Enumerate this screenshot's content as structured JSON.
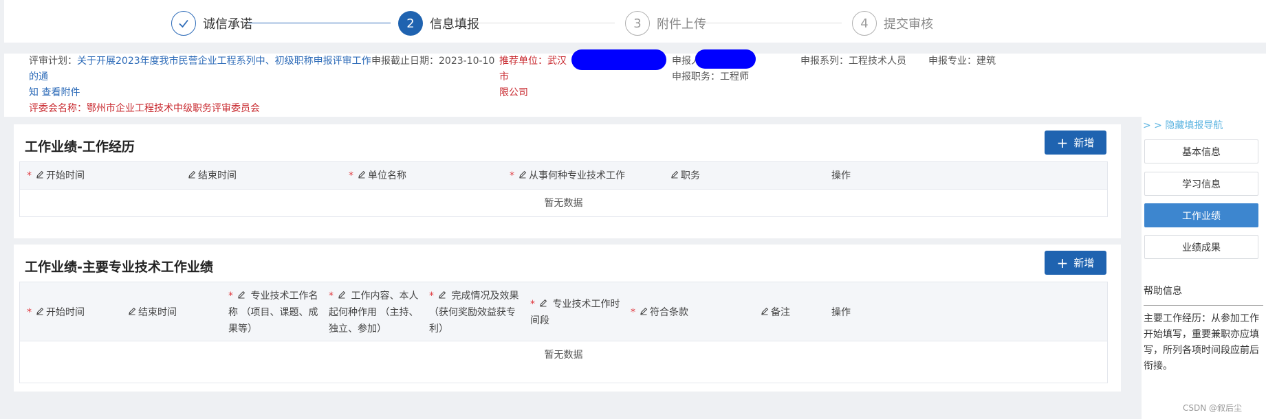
{
  "stepper": {
    "steps": [
      {
        "index": "✓",
        "label": "诚信承诺"
      },
      {
        "index": "2",
        "label": "信息填报"
      },
      {
        "index": "3",
        "label": "附件上传"
      },
      {
        "index": "4",
        "label": "提交审核"
      }
    ]
  },
  "info": {
    "plan_label": "评审计划：",
    "plan_value_line1": "关于开展2023年度我市民营企业工程系列中、初级职称申报评审工作的通",
    "plan_value_line2": "知",
    "view_attachment": "查看附件",
    "deadline_label": "申报截止日期：",
    "deadline_value": "2023-10-10",
    "committee": "评委会名称：鄂州市企业工程技术中级职务评审委员会",
    "recommend_label": "推荐单位：",
    "recommend_value_line1": "武汉市",
    "recommend_value_line2": "限公司",
    "applicant_label": "申报人",
    "position_label": "申报职务：",
    "position_value": "工程师",
    "series_label": "申报系列：",
    "series_value": "工程技术人员",
    "specialty_label": "申报专业：",
    "specialty_value": "建筑"
  },
  "section1": {
    "title": "工作业绩-工作经历",
    "add_label": "新增",
    "columns": [
      "开始时间",
      "结束时间",
      "单位名称",
      "从事何种专业技术工作",
      "职务",
      "操作"
    ],
    "empty": "暂无数据"
  },
  "section2": {
    "title": "工作业绩-主要专业技术工作业绩",
    "add_label": "新增",
    "columns": [
      "开始时间",
      "结束时间",
      "专业技术工作名称 （项目、课题、成果等）",
      "工作内容、本人起何种作用 （主持、独立、参加）",
      "完成情况及效果 （获何奖励效益获专利）",
      "专业技术工作时间段",
      "符合条款",
      "备注",
      "操作"
    ],
    "col3": [
      "专业技术工作名",
      "称 （项目、课题、成",
      "果等）"
    ],
    "col4": [
      "工作内容、本人",
      "起何种作用 （主持、",
      "独立、参加）"
    ],
    "col5": [
      "完成情况及效果",
      " （获何奖励效益获专",
      "利）"
    ],
    "col6": [
      "专业技术工作时",
      "间段"
    ],
    "empty": "暂无数据"
  },
  "sidebar": {
    "hide_nav": "> > 隐藏填报导航",
    "items": [
      "基本信息",
      "学习信息",
      "工作业绩",
      "业绩成果"
    ],
    "active": "工作业绩",
    "help_title": "帮助信息",
    "help_text": "主要工作经历：从参加工作开始填写，重要兼职亦应填写，所列各项时间段应前后衔接。"
  },
  "watermark": "CSDN @叙后尘",
  "colors": {
    "primary": "#1f63b0",
    "required": "#e0383e",
    "link": "#2d6bb8",
    "warning_text": "#c8282e"
  }
}
